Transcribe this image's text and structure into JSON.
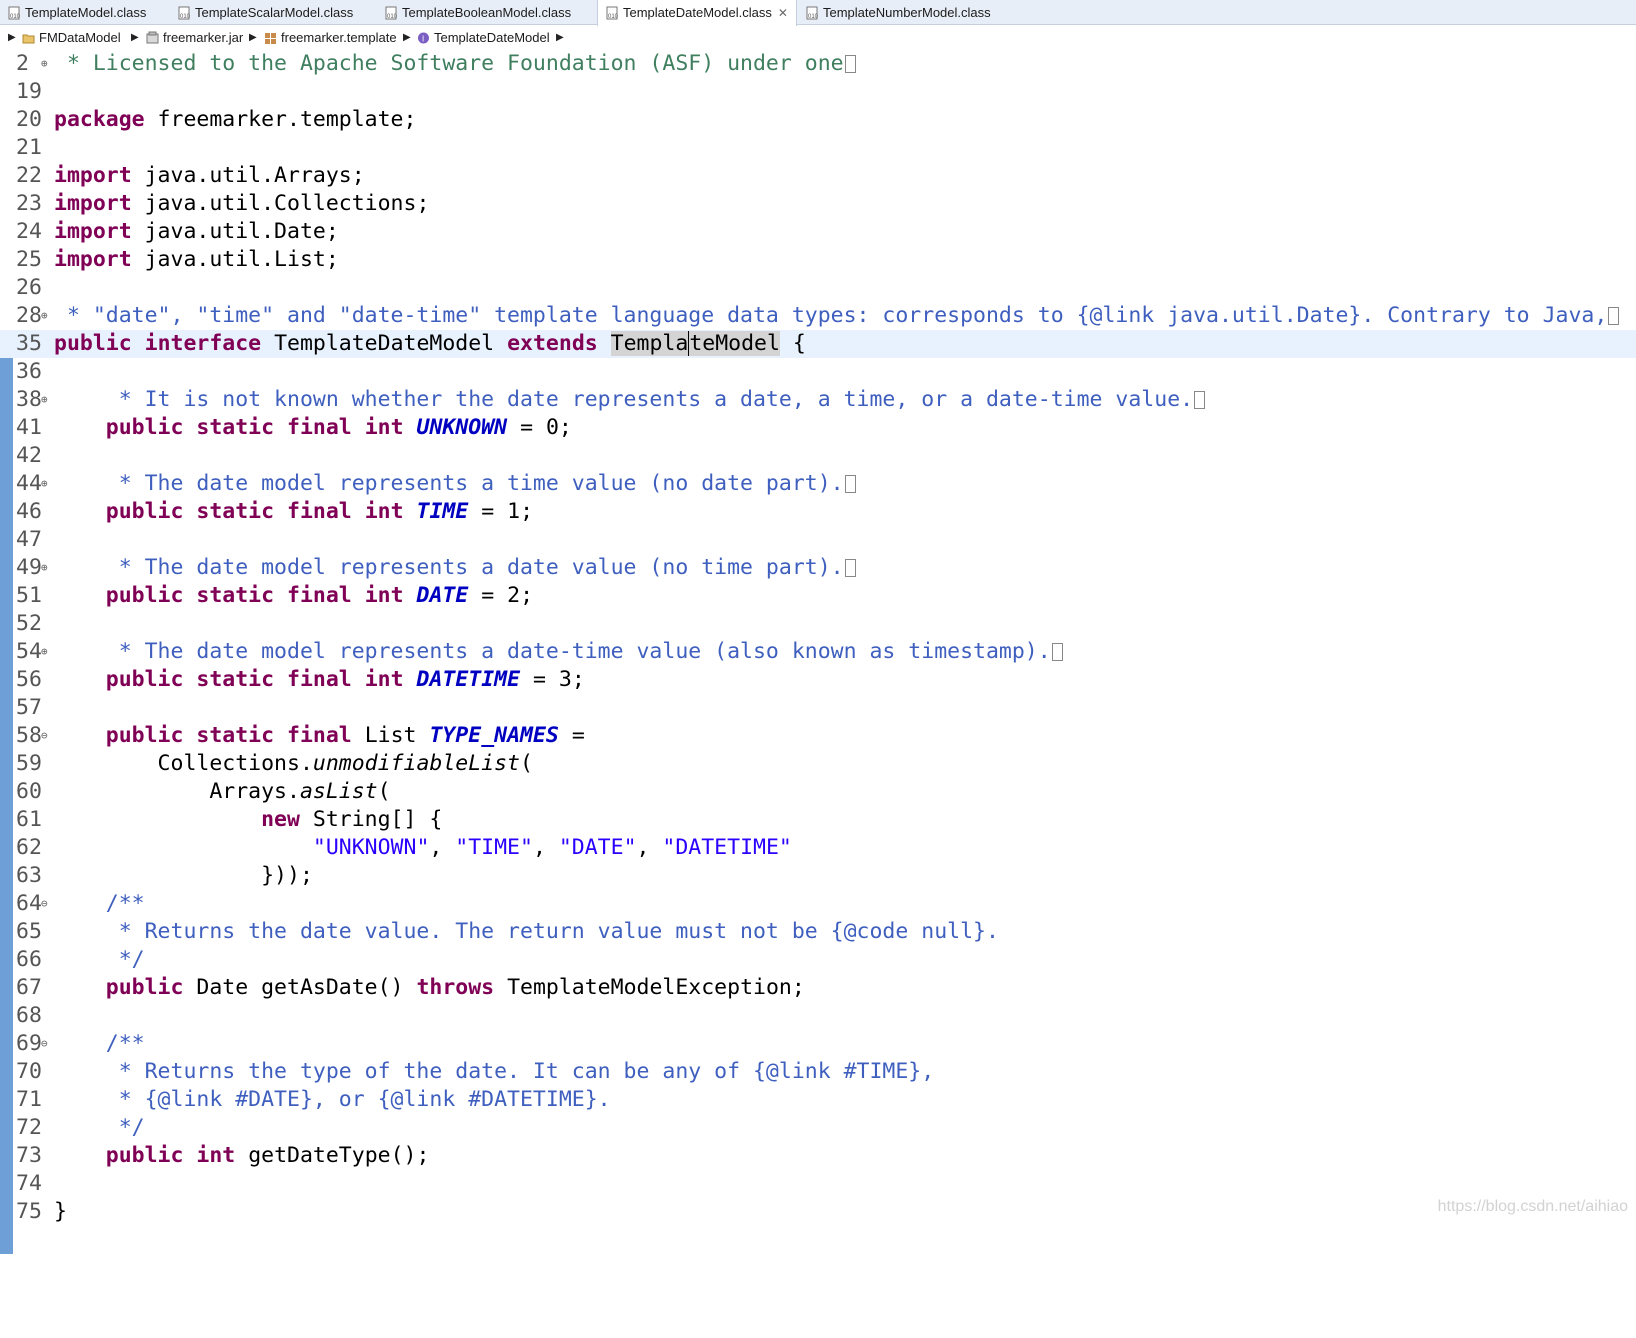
{
  "tabs": [
    {
      "label": "TemplateModel.class",
      "active": false
    },
    {
      "label": "TemplateScalarModel.class",
      "active": false
    },
    {
      "label": "TemplateBooleanModel.class",
      "active": false
    },
    {
      "label": "TemplateDateModel.class",
      "active": true
    },
    {
      "label": "TemplateNumberModel.class",
      "active": false
    }
  ],
  "tab_close_glyph": "✕",
  "breadcrumb": {
    "project": "FMDataModel",
    "jar": "freemarker.jar",
    "package": "freemarker.template",
    "type": "TemplateDateModel"
  },
  "editor": {
    "lines": [
      {
        "n": "2",
        "fold": "⊕"
      },
      {
        "n": "19"
      },
      {
        "n": "20"
      },
      {
        "n": "21"
      },
      {
        "n": "22"
      },
      {
        "n": "23"
      },
      {
        "n": "24"
      },
      {
        "n": "25"
      },
      {
        "n": "26"
      },
      {
        "n": "28",
        "fold": "⊕"
      },
      {
        "n": "35"
      },
      {
        "n": "36"
      },
      {
        "n": "38",
        "fold": "⊕"
      },
      {
        "n": "41"
      },
      {
        "n": "42"
      },
      {
        "n": "44",
        "fold": "⊕"
      },
      {
        "n": "46"
      },
      {
        "n": "47"
      },
      {
        "n": "49",
        "fold": "⊕"
      },
      {
        "n": "51"
      },
      {
        "n": "52"
      },
      {
        "n": "54",
        "fold": "⊕"
      },
      {
        "n": "56"
      },
      {
        "n": "57"
      },
      {
        "n": "58",
        "fold": "⊖"
      },
      {
        "n": "59"
      },
      {
        "n": "60"
      },
      {
        "n": "61"
      },
      {
        "n": "62"
      },
      {
        "n": "63"
      },
      {
        "n": "64",
        "fold": "⊖"
      },
      {
        "n": "65"
      },
      {
        "n": "66"
      },
      {
        "n": "67"
      },
      {
        "n": "68"
      },
      {
        "n": "69",
        "fold": "⊖"
      },
      {
        "n": "70"
      },
      {
        "n": "71"
      },
      {
        "n": "72"
      },
      {
        "n": "73"
      },
      {
        "n": "74"
      },
      {
        "n": "75"
      }
    ],
    "code": {
      "l2": " * Licensed to the Apache Software Foundation (ASF) under one",
      "l20_kw": "package",
      "l20_rest": " freemarker.template;",
      "import_kw": "import",
      "l22_rest": " java.util.Arrays;",
      "l23_rest": " java.util.Collections;",
      "l24_rest": " java.util.Date;",
      "l25_rest": " java.util.List;",
      "l28": " * \"date\", \"time\" and \"date-time\" template language data types: corresponds to {@link java.util.Date}. Contrary to Java,",
      "kw_public": "public",
      "kw_interface": "interface",
      "l35_name": "TemplateDateModel",
      "kw_extends": "extends",
      "l35_super_a": "Templa",
      "l35_super_b": "teModel",
      "l35_end": " {",
      "l38": "     * It is not known whether the date represents a date, a time, or a date-time value.",
      "kw_static": "static",
      "kw_final": "final",
      "kw_int": "int",
      "l41_field": "UNKNOWN",
      "l41_end": " = 0;",
      "l44": "     * The date model represents a time value (no date part).",
      "l46_field": "TIME",
      "l46_end": " = 1;",
      "l49": "     * The date model represents a date value (no time part).",
      "l51_field": "DATE",
      "l51_end": " = 2;",
      "l54": "     * The date model represents a date-time value (also known as timestamp).",
      "l56_field": "DATETIME",
      "l56_end": " = 3;",
      "l58_type": " List ",
      "l58_field": "TYPE_NAMES",
      "l58_end": " =",
      "l59_a": "        Collections.",
      "l59_b": "unmodifiableList",
      "l59_c": "(",
      "l60_a": "            Arrays.",
      "l60_b": "asList",
      "l60_c": "(",
      "l61_kw": "new",
      "l61_rest": " String[] {",
      "l62_s1": "\"UNKNOWN\"",
      "l62_s2": "\"TIME\"",
      "l62_s3": "\"DATE\"",
      "l62_s4": "\"DATETIME\"",
      "l63": "                }));",
      "l64": "    /**",
      "l65": "     * Returns the date value. The return value must not be {@code null}.",
      "l66": "     */",
      "l67_a": " Date getAsDate() ",
      "kw_throws": "throws",
      "l67_b": " TemplateModelException;",
      "l69": "    /**",
      "l70": "     * Returns the type of the date. It can be any of {@link #TIME},",
      "l71": "     * {@link #DATE}, or {@link #DATETIME}.",
      "l72": "     */",
      "l73_b": " getDateType();",
      "l75": "}"
    }
  },
  "watermark": "https://blog.csdn.net/aihiao"
}
